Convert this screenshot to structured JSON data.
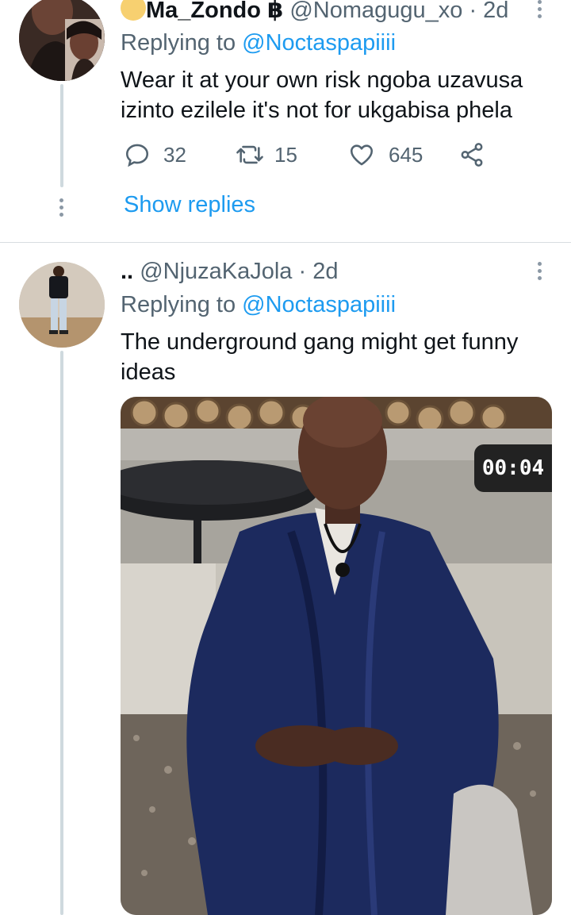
{
  "tweet1": {
    "display_name": "Ma_Zondo",
    "name_emoji": "฿",
    "handle": "@Nomagugu_xo",
    "time": "· 2d",
    "replying_prefix": "Replying to",
    "replying_handle": "@Noctaspapiiii",
    "text_line1": "Wear it at your own risk ngoba uzavusa",
    "text_line2": "izinto ezilele it's not for ukgabisa  phela",
    "replies_count": "32",
    "retweets_count": "15",
    "likes_count": "645",
    "show_replies_label": "Show replies"
  },
  "tweet2": {
    "display_name": "..",
    "handle": "@NjuzaKaJola",
    "time": "· 2d",
    "replying_prefix": "Replying to",
    "replying_handle": "@Noctaspapiiii",
    "text_line1": "The underground gang might get funny",
    "text_line2": "ideas",
    "media_timer": "00:04"
  },
  "colors": {
    "link": "#1d9bf0",
    "muted": "#536471",
    "thread_line": "#cfd9de",
    "robe": "#1c2a5e"
  },
  "icons": [
    "more-icon",
    "reply-icon",
    "retweet-icon",
    "like-icon",
    "share-icon"
  ]
}
